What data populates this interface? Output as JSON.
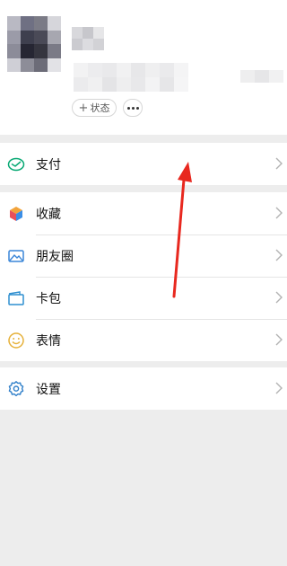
{
  "profile": {
    "status_label": "状态",
    "status_plus": "+"
  },
  "menu": {
    "pay": "支付",
    "favorites": "收藏",
    "moments": "朋友圈",
    "cards": "卡包",
    "stickers": "表情",
    "settings": "设置"
  },
  "colors": {
    "accent_green": "#07c160",
    "annotation_red": "#e8281f",
    "background": "#ededed"
  }
}
